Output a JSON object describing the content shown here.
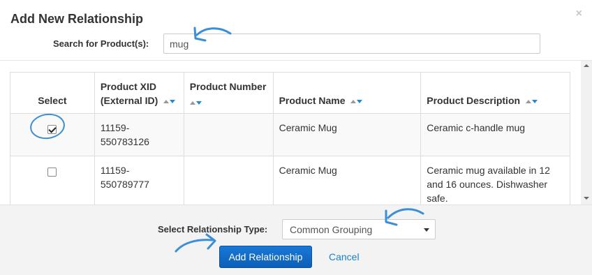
{
  "modal": {
    "title": "Add New Relationship",
    "close_glyph": "×"
  },
  "search": {
    "label": "Search for Product(s):",
    "value": "mug"
  },
  "table": {
    "headers": {
      "select": "Select",
      "xid_line1": "Product XID",
      "xid_line2": "(External ID)",
      "number": "Product Number",
      "name": "Product Name",
      "description": "Product Description"
    },
    "rows": [
      {
        "checked": true,
        "xid_line1": "11159-",
        "xid_line2": "550783126",
        "number": "",
        "name": "Ceramic Mug",
        "description": "Ceramic c-handle mug"
      },
      {
        "checked": false,
        "xid_line1": "11159-",
        "xid_line2": "550789777",
        "number": "",
        "name": "Ceramic Mug",
        "description": "Ceramic mug available in 12 and 16 ounces. Dishwasher safe."
      }
    ]
  },
  "footer": {
    "relationship_label": "Select Relationship Type:",
    "relationship_value": "Common Grouping",
    "add_button": "Add Relationship",
    "cancel": "Cancel"
  },
  "colors": {
    "accent": "#1a78d6",
    "link": "#1a7fc9",
    "annotation": "#3b8fd6"
  }
}
